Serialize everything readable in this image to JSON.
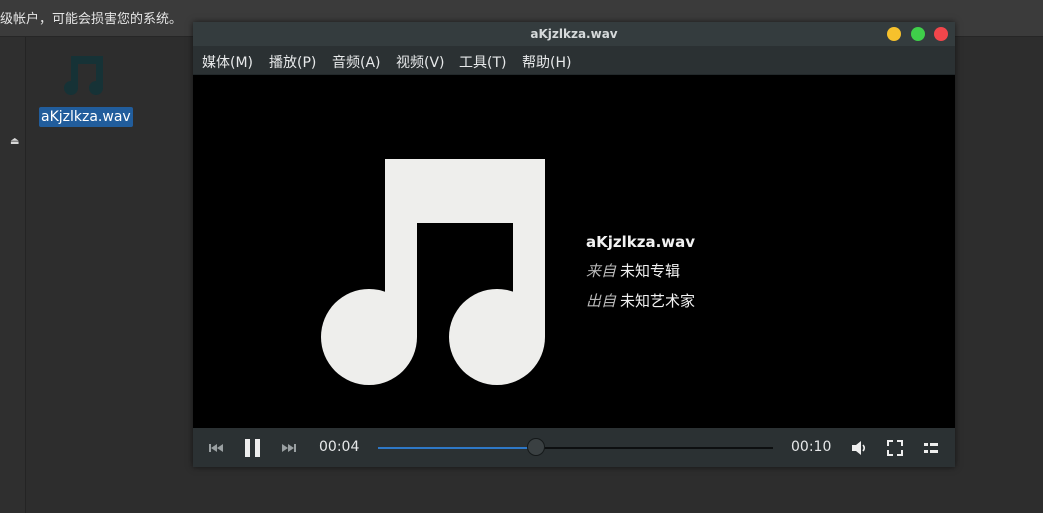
{
  "desktop": {
    "warning_text": "级帐户，可能会损害您的系统。",
    "file": {
      "name": "aKjzlkza.wav",
      "icon": "music-note-icon"
    },
    "sidebar": {
      "eject_icon": "eject-icon"
    }
  },
  "window": {
    "title": "aKjzlkza.wav",
    "buttons": {
      "minimize": "#f6c12c",
      "maximize": "#3fcf4a",
      "close": "#f1464b"
    }
  },
  "menu": [
    "媒体(M)",
    "播放(P)",
    "音频(A)",
    "视频(V)",
    "工具(T)",
    "帮助(H)"
  ],
  "media": {
    "title": "aKjzlkza.wav",
    "album_prefix": "来自",
    "album": "未知专辑",
    "artist_prefix": "出自",
    "artist": "未知艺术家",
    "cover_icon": "music-note-icon"
  },
  "controls": {
    "elapsed": "00:04",
    "total": "00:10",
    "progress": 0.4,
    "accent": "#2e78c7",
    "icons": [
      "previous-icon",
      "pause-icon",
      "next-icon",
      "volume-icon",
      "fullscreen-icon",
      "playlist-icon"
    ]
  }
}
